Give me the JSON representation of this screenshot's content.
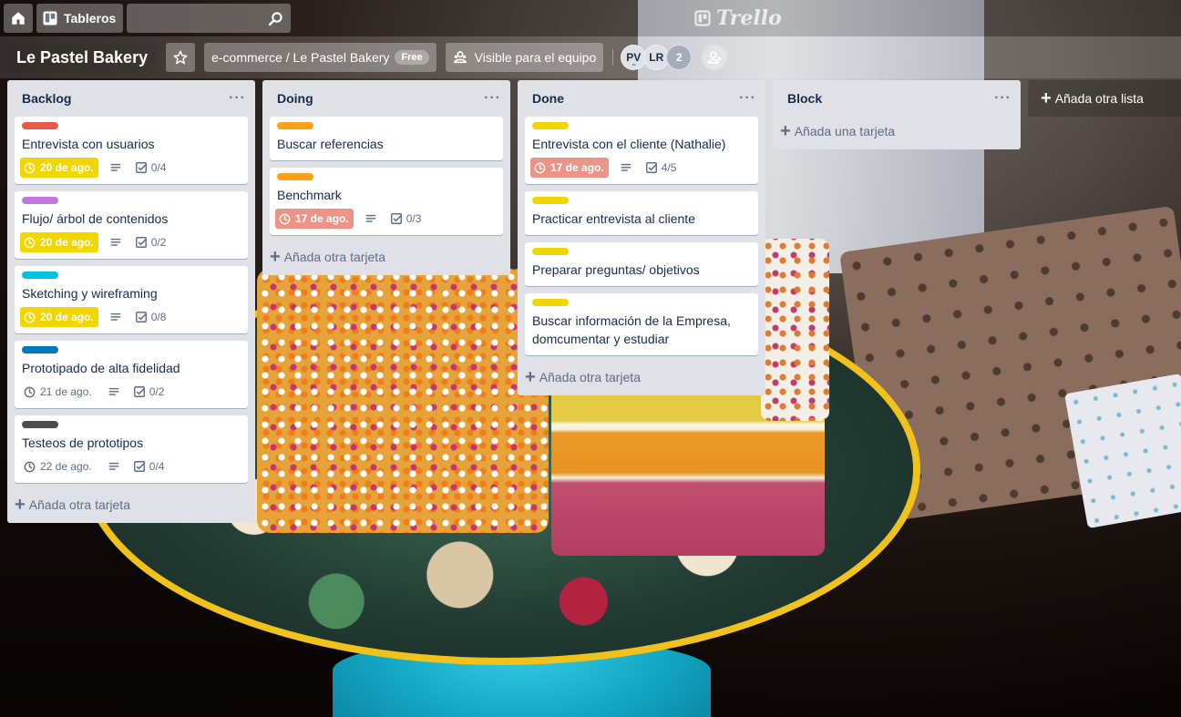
{
  "header": {
    "boards_label": "Tableros",
    "search_placeholder": "",
    "logo_text": "Trello"
  },
  "board": {
    "title": "Le Pastel Bakery",
    "team_label": "e-commerce / Le Pastel Bakery",
    "plan_badge": "Free",
    "visibility_label": "Visible para el equipo",
    "members": [
      "PV",
      "LR"
    ],
    "extra_members": "2"
  },
  "lists": [
    {
      "title": "Backlog",
      "add_label": "Añada otra tarjeta",
      "cards": [
        {
          "label_color": "#eb5a46",
          "title": "Entrevista con usuarios",
          "due": "20 de ago.",
          "due_state": "yellow",
          "checklist": "0/4"
        },
        {
          "label_color": "#c377e0",
          "title": "Flujo/ árbol de contenidos",
          "due": "20 de ago.",
          "due_state": "yellow",
          "checklist": "0/2"
        },
        {
          "label_color": "#00c2e0",
          "title": "Sketching y wireframing",
          "due": "20 de ago.",
          "due_state": "yellow",
          "checklist": "0/8"
        },
        {
          "label_color": "#0079bf",
          "title": "Prototipado de alta fidelidad",
          "due": "21 de ago.",
          "due_state": "plain",
          "checklist": "0/2"
        },
        {
          "label_color": "#4d4d4d",
          "title": "Testeos de prototipos",
          "due": "22 de ago.",
          "due_state": "plain",
          "checklist": "0/4"
        }
      ]
    },
    {
      "title": "Doing",
      "add_label": "Añada otra tarjeta",
      "cards": [
        {
          "label_color": "#ff9f1a",
          "title": "Buscar referencias"
        },
        {
          "label_color": "#ff9f1a",
          "title": "Benchmark",
          "due": "17 de ago.",
          "due_state": "red",
          "checklist": "0/3"
        }
      ]
    },
    {
      "title": "Done",
      "add_label": "Añada otra tarjeta",
      "cards": [
        {
          "label_color": "#f2d600",
          "title": "Entrevista con el cliente (Nathalie)",
          "due": "17 de ago.",
          "due_state": "red",
          "checklist": "4/5"
        },
        {
          "label_color": "#f2d600",
          "title": "Practicar entrevista al cliente"
        },
        {
          "label_color": "#f2d600",
          "title": "Preparar preguntas/ objetivos"
        },
        {
          "label_color": "#f2d600",
          "title": "Buscar información de la Empresa, domcumentar y estudiar"
        }
      ]
    },
    {
      "title": "Block",
      "add_label": "Añada una tarjeta",
      "cards": []
    }
  ],
  "add_list_label": "Añada otra lista",
  "icons": {
    "home": "home-icon",
    "boards": "boards-icon",
    "search": "search-icon",
    "star": "star-icon",
    "visibility": "team-visibility-icon",
    "invite": "add-member-icon",
    "clock": "clock-icon",
    "description": "description-icon",
    "checklist": "checklist-icon"
  }
}
